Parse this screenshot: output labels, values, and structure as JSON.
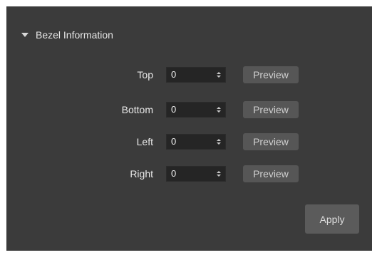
{
  "section": {
    "title": "Bezel Information"
  },
  "rows": [
    {
      "label": "Top",
      "value": "0",
      "preview_label": "Preview"
    },
    {
      "label": "Bottom",
      "value": "0",
      "preview_label": "Preview"
    },
    {
      "label": "Left",
      "value": "0",
      "preview_label": "Preview"
    },
    {
      "label": "Right",
      "value": "0",
      "preview_label": "Preview"
    }
  ],
  "apply_label": "Apply",
  "colors": {
    "panel_background": "#3b3b3b",
    "input_background": "#252525",
    "button_background": "#565656",
    "text": "#e9e9e9"
  },
  "icons": {
    "section_toggle": "caret-down-icon",
    "spinner": "spinner-arrows-icon"
  }
}
